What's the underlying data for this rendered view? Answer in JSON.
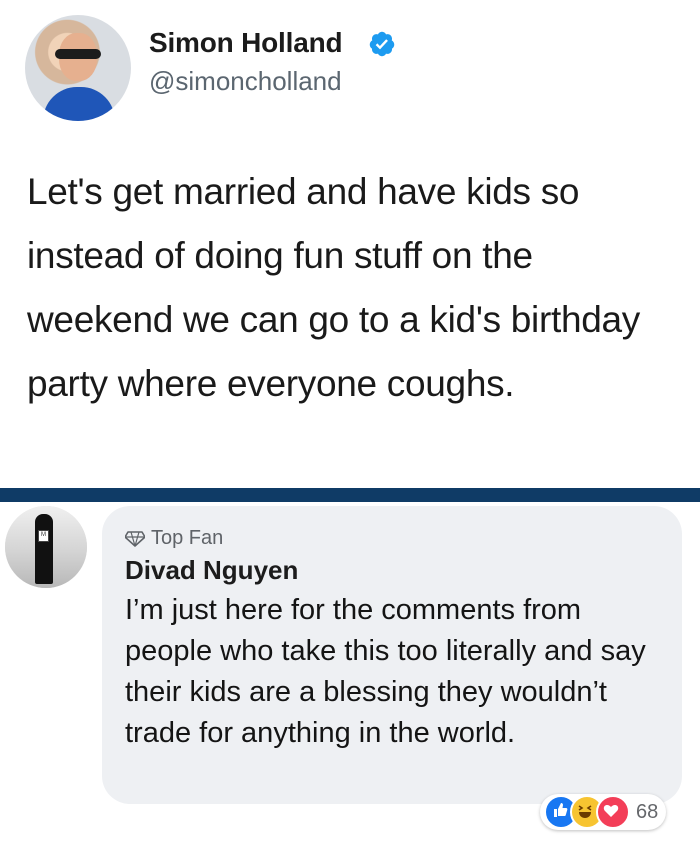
{
  "tweet": {
    "author_name": "Simon Holland",
    "handle": "@simoncholland",
    "text": "Let's get married and have kids so instead of doing fun stuff on the weekend we can go to a kid's birthday party where everyone coughs."
  },
  "comment": {
    "badge": "Top Fan",
    "author_name": "Divad Nguyen",
    "text": "I’m just here for the comments from people who take this too literally and say their kids are a blessing they wouldn’t trade for anything in the world.",
    "reaction_count": "68"
  },
  "colors": {
    "divider": "#0f3b66",
    "verified": "#1d9bf0",
    "like": "#1877f2",
    "haha": "#f7c431",
    "love": "#f33e58"
  },
  "icons": [
    "verified-badge-icon",
    "top-fan-gem-icon",
    "like-reaction-icon",
    "haha-reaction-icon",
    "love-reaction-icon"
  ]
}
